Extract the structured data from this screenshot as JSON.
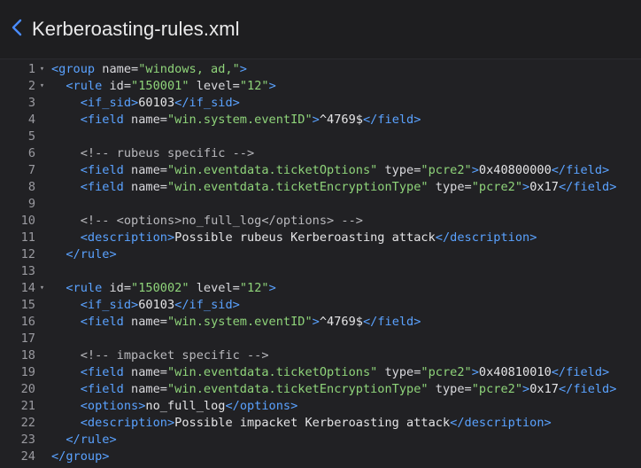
{
  "header": {
    "title": "Kerberoasting-rules.xml",
    "back_icon": "chevron-left-icon"
  },
  "editor": {
    "fold_lines": [
      1,
      2,
      14
    ],
    "lines": [
      [
        [
          "tag",
          "<group "
        ],
        [
          "attr",
          "name="
        ],
        [
          "str",
          "\"windows, ad,\""
        ],
        [
          "tag",
          ">"
        ]
      ],
      [
        [
          "txt",
          "  "
        ],
        [
          "tag",
          "<rule "
        ],
        [
          "attr",
          "id="
        ],
        [
          "str",
          "\"150001\""
        ],
        [
          "attr",
          " level="
        ],
        [
          "str",
          "\"12\""
        ],
        [
          "tag",
          ">"
        ]
      ],
      [
        [
          "txt",
          "    "
        ],
        [
          "tag",
          "<if_sid>"
        ],
        [
          "txt",
          "60103"
        ],
        [
          "tag",
          "</if_sid>"
        ]
      ],
      [
        [
          "txt",
          "    "
        ],
        [
          "tag",
          "<field "
        ],
        [
          "attr",
          "name="
        ],
        [
          "str",
          "\"win.system.eventID\""
        ],
        [
          "tag",
          ">"
        ],
        [
          "txt",
          "^4769$"
        ],
        [
          "tag",
          "</field>"
        ]
      ],
      [],
      [
        [
          "txt",
          "    "
        ],
        [
          "cmt",
          "<!-- rubeus specific -->"
        ]
      ],
      [
        [
          "txt",
          "    "
        ],
        [
          "tag",
          "<field "
        ],
        [
          "attr",
          "name="
        ],
        [
          "str",
          "\"win.eventdata.ticketOptions\""
        ],
        [
          "attr",
          " type="
        ],
        [
          "str",
          "\"pcre2\""
        ],
        [
          "tag",
          ">"
        ],
        [
          "txt",
          "0x40800000"
        ],
        [
          "tag",
          "</field>"
        ]
      ],
      [
        [
          "txt",
          "    "
        ],
        [
          "tag",
          "<field "
        ],
        [
          "attr",
          "name="
        ],
        [
          "str",
          "\"win.eventdata.ticketEncryptionType\""
        ],
        [
          "attr",
          " type="
        ],
        [
          "str",
          "\"pcre2\""
        ],
        [
          "tag",
          ">"
        ],
        [
          "txt",
          "0x17"
        ],
        [
          "tag",
          "</field>"
        ]
      ],
      [],
      [
        [
          "txt",
          "    "
        ],
        [
          "cmt",
          "<!-- <options>no_full_log</options> -->"
        ]
      ],
      [
        [
          "txt",
          "    "
        ],
        [
          "tag",
          "<description>"
        ],
        [
          "txt",
          "Possible rubeus Kerberoasting attack"
        ],
        [
          "tag",
          "</description>"
        ]
      ],
      [
        [
          "txt",
          "  "
        ],
        [
          "tag",
          "</rule>"
        ]
      ],
      [],
      [
        [
          "txt",
          "  "
        ],
        [
          "tag",
          "<rule "
        ],
        [
          "attr",
          "id="
        ],
        [
          "str",
          "\"150002\""
        ],
        [
          "attr",
          " level="
        ],
        [
          "str",
          "\"12\""
        ],
        [
          "tag",
          ">"
        ]
      ],
      [
        [
          "txt",
          "    "
        ],
        [
          "tag",
          "<if_sid>"
        ],
        [
          "txt",
          "60103"
        ],
        [
          "tag",
          "</if_sid>"
        ]
      ],
      [
        [
          "txt",
          "    "
        ],
        [
          "tag",
          "<field "
        ],
        [
          "attr",
          "name="
        ],
        [
          "str",
          "\"win.system.eventID\""
        ],
        [
          "tag",
          ">"
        ],
        [
          "txt",
          "^4769$"
        ],
        [
          "tag",
          "</field>"
        ]
      ],
      [],
      [
        [
          "txt",
          "    "
        ],
        [
          "cmt",
          "<!-- impacket specific -->"
        ]
      ],
      [
        [
          "txt",
          "    "
        ],
        [
          "tag",
          "<field "
        ],
        [
          "attr",
          "name="
        ],
        [
          "str",
          "\"win.eventdata.ticketOptions\""
        ],
        [
          "attr",
          " type="
        ],
        [
          "str",
          "\"pcre2\""
        ],
        [
          "tag",
          ">"
        ],
        [
          "txt",
          "0x40810010"
        ],
        [
          "tag",
          "</field>"
        ]
      ],
      [
        [
          "txt",
          "    "
        ],
        [
          "tag",
          "<field "
        ],
        [
          "attr",
          "name="
        ],
        [
          "str",
          "\"win.eventdata.ticketEncryptionType\""
        ],
        [
          "attr",
          " type="
        ],
        [
          "str",
          "\"pcre2\""
        ],
        [
          "tag",
          ">"
        ],
        [
          "txt",
          "0x17"
        ],
        [
          "tag",
          "</field>"
        ]
      ],
      [
        [
          "txt",
          "    "
        ],
        [
          "tag",
          "<options>"
        ],
        [
          "txt",
          "no_full_log"
        ],
        [
          "tag",
          "</options>"
        ]
      ],
      [
        [
          "txt",
          "    "
        ],
        [
          "tag",
          "<description>"
        ],
        [
          "txt",
          "Possible impacket Kerberoasting attack"
        ],
        [
          "tag",
          "</description>"
        ]
      ],
      [
        [
          "txt",
          "  "
        ],
        [
          "tag",
          "</rule>"
        ]
      ],
      [
        [
          "tag",
          "</group>"
        ]
      ]
    ]
  }
}
